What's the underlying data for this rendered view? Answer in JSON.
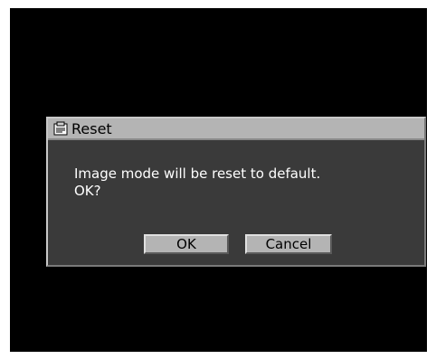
{
  "dialog": {
    "title": "Reset",
    "title_icon": "reset-document-icon",
    "message_line1": "Image mode will be reset to default.",
    "message_line2": "OK?",
    "ok_label": "OK",
    "cancel_label": "Cancel"
  },
  "colors": {
    "screen_background": "#000000",
    "dialog_background": "#3a3a3a",
    "titlebar_background": "#b4b4b4",
    "button_background": "#b4b4b4",
    "message_text": "#ffffff"
  }
}
